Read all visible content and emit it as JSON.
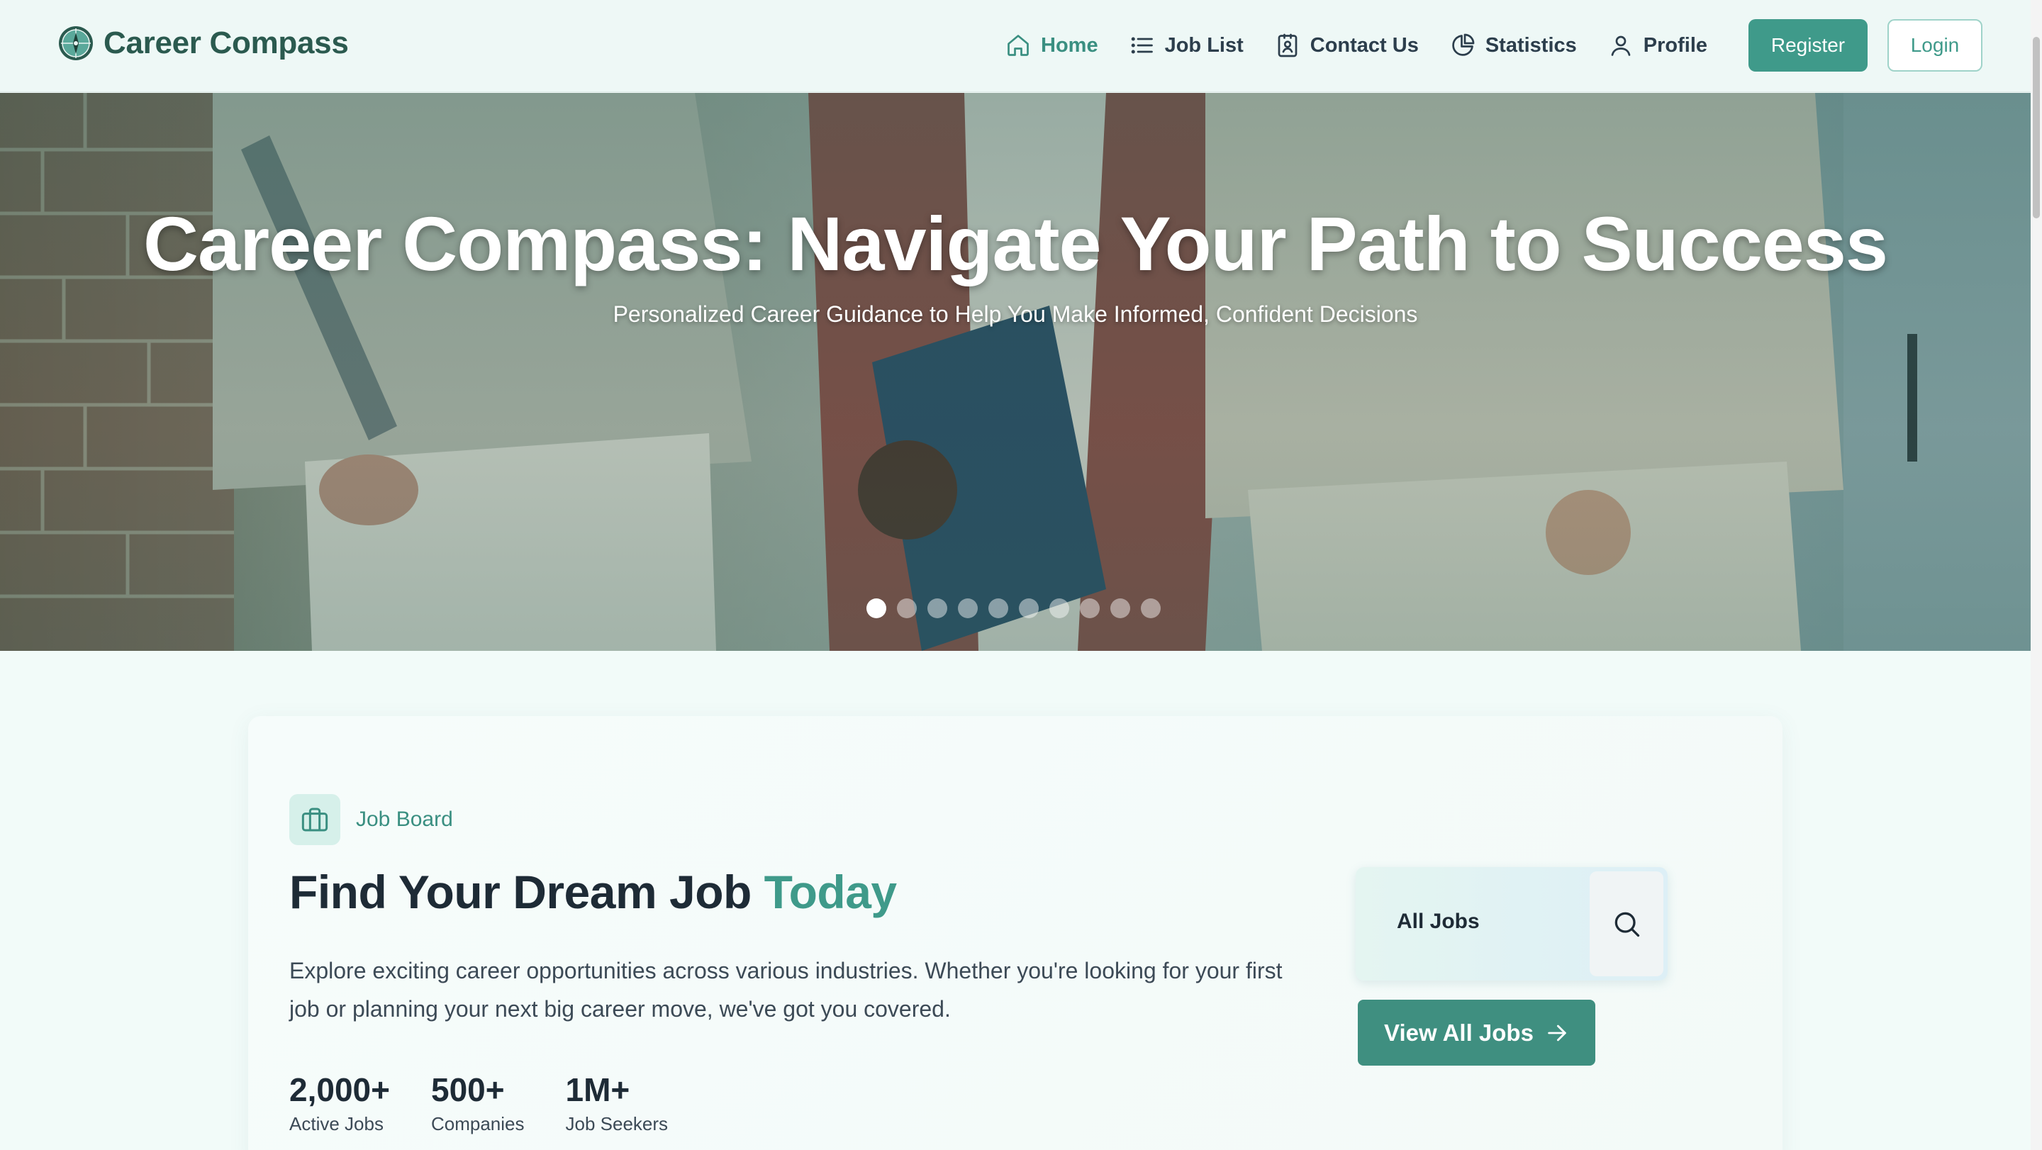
{
  "brand": {
    "name": "Career Compass",
    "logo_icon": "compass-icon"
  },
  "nav": {
    "items": [
      {
        "label": "Home",
        "icon": "home-icon",
        "active": true
      },
      {
        "label": "Job List",
        "icon": "list-icon",
        "active": false
      },
      {
        "label": "Contact Us",
        "icon": "contact-card-icon",
        "active": false
      },
      {
        "label": "Statistics",
        "icon": "pie-chart-icon",
        "active": false
      },
      {
        "label": "Profile",
        "icon": "user-icon",
        "active": false
      }
    ],
    "register_label": "Register",
    "login_label": "Login"
  },
  "hero": {
    "title": "Career Compass: Navigate Your Path to Success",
    "subtitle": "Personalized Career Guidance to Help You Make Informed, Confident Decisions",
    "slide_count": 10,
    "active_slide": 1
  },
  "job_board": {
    "badge_label": "Job Board",
    "badge_icon": "briefcase-icon",
    "heading_main": "Find Your Dream Job ",
    "heading_accent": "Today",
    "description": "Explore exciting career opportunities across various industries. Whether you're looking for your first job or planning your next big career move, we've got you covered.",
    "stats": [
      {
        "value": "2,000+",
        "label": "Active Jobs"
      },
      {
        "value": "500+",
        "label": "Companies"
      },
      {
        "value": "1M+",
        "label": "Job Seekers"
      }
    ],
    "search_label": "All Jobs",
    "search_icon": "search-icon",
    "view_all_label": "View All Jobs",
    "view_all_icon": "arrow-right-icon"
  },
  "colors": {
    "accent": "#3f9a8a",
    "brand_text": "#2b5a4f",
    "header_bg": "#eef8f6",
    "page_bg": "#f2fbf9"
  }
}
